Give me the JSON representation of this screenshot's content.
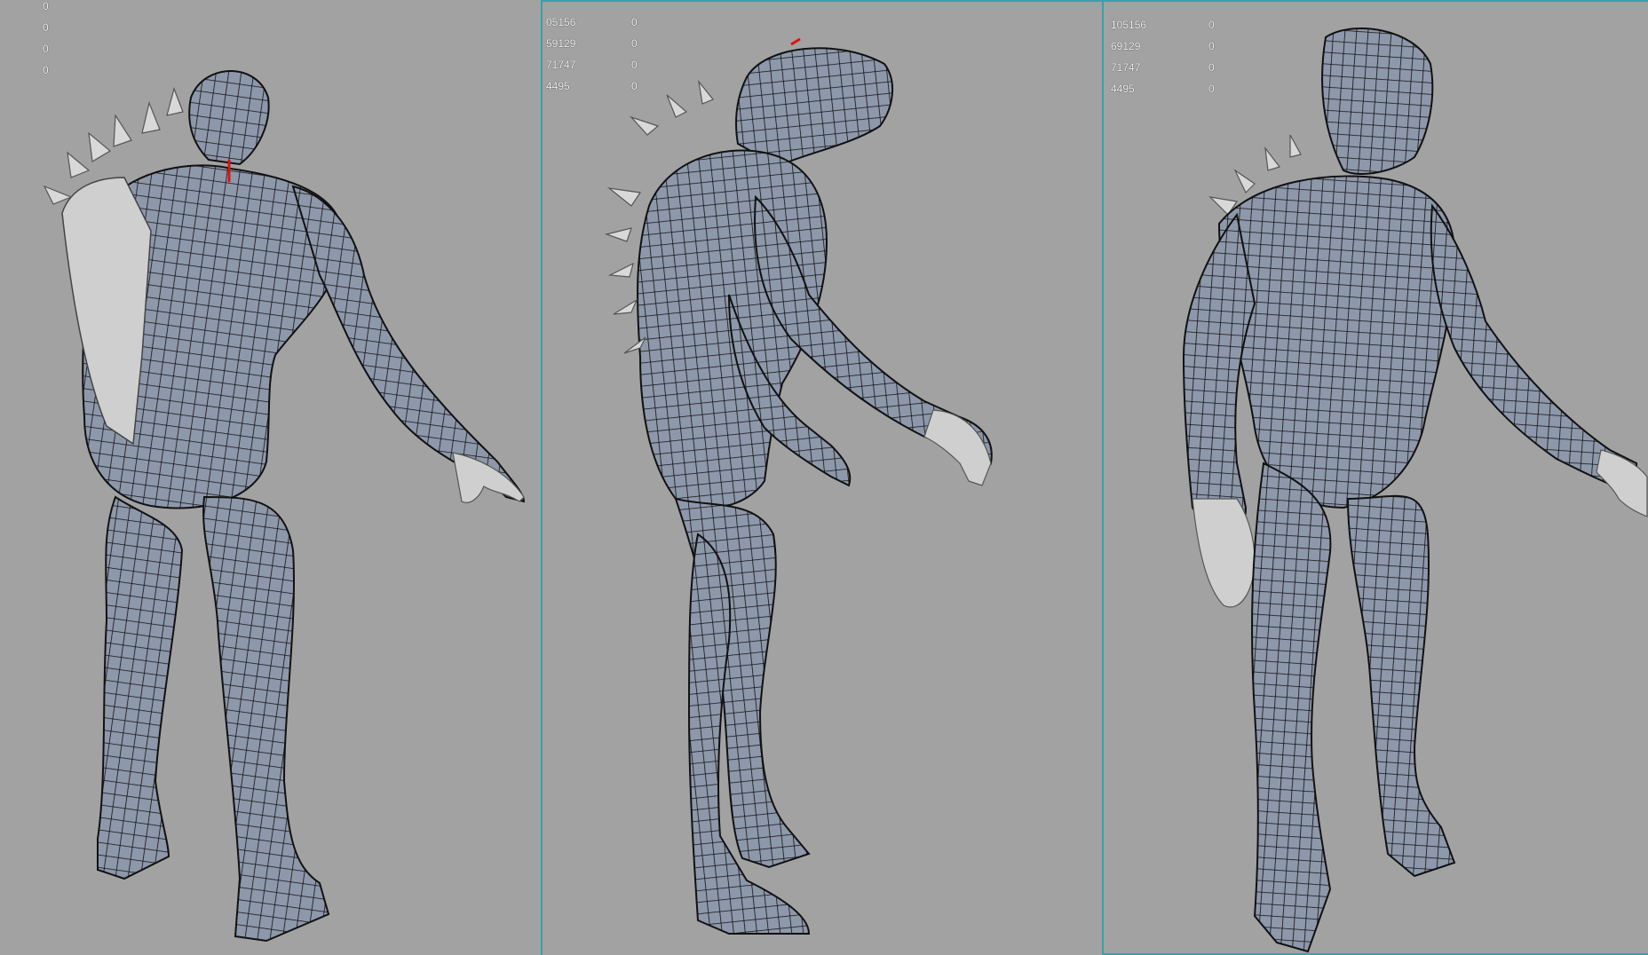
{
  "viewports": [
    {
      "name": "perspective-view-left",
      "hud_rows": [
        {
          "value": "0"
        },
        {
          "value": "0"
        },
        {
          "value": "0"
        },
        {
          "value": "0"
        }
      ]
    },
    {
      "name": "perspective-view-center",
      "hud_rows": [
        {
          "count": "05156",
          "value": "0"
        },
        {
          "count": "59129",
          "value": "0"
        },
        {
          "count": "71747",
          "value": "0"
        },
        {
          "count": "4495",
          "value": "0"
        }
      ]
    },
    {
      "name": "perspective-view-right",
      "hud_rows": [
        {
          "count": "105156",
          "value": "0"
        },
        {
          "count": "69129",
          "value": "0"
        },
        {
          "count": "71747",
          "value": "0"
        },
        {
          "count": "4495",
          "value": "0"
        }
      ]
    }
  ],
  "colors": {
    "background": "#a2a2a2",
    "mesh_fill": "#8e98ab",
    "wire": "#111111",
    "accent_border": "#3aa0a8",
    "spikes": "#cfcfcf"
  }
}
